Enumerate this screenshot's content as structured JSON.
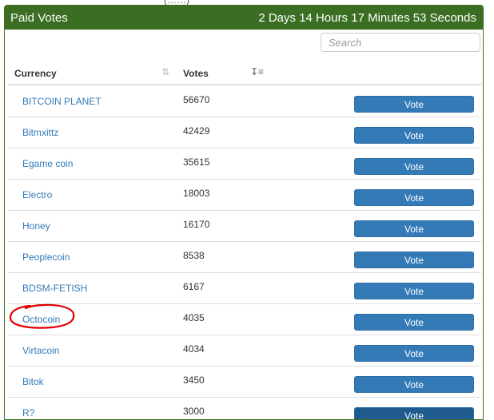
{
  "top_cut_text": "(……)",
  "panel": {
    "title": "Paid Votes",
    "countdown": "2 Days 14 Hours 17 Minutes 53 Seconds"
  },
  "search": {
    "placeholder": "Search"
  },
  "table": {
    "headers": {
      "currency": "Currency",
      "votes": "Votes"
    },
    "rows": [
      {
        "currency": "BITCOIN PLANET",
        "votes": "56670",
        "action": "Vote"
      },
      {
        "currency": "Bitmxittz",
        "votes": "42429",
        "action": "Vote"
      },
      {
        "currency": "Egame coin",
        "votes": "35615",
        "action": "Vote"
      },
      {
        "currency": "Electro",
        "votes": "18003",
        "action": "Vote"
      },
      {
        "currency": "Honey",
        "votes": "16170",
        "action": "Vote"
      },
      {
        "currency": "Peoplecoin",
        "votes": "8538",
        "action": "Vote"
      },
      {
        "currency": "BDSM-FETISH",
        "votes": "6167",
        "action": "Vote"
      },
      {
        "currency": "Octocoin",
        "votes": "4035",
        "action": "Vote"
      },
      {
        "currency": "Virtacoin",
        "votes": "4034",
        "action": "Vote"
      },
      {
        "currency": "Bitok",
        "votes": "3450",
        "action": "Vote"
      },
      {
        "currency": "R?",
        "votes": "3000",
        "action": "Vote"
      }
    ]
  },
  "colors": {
    "header_bg": "#3b6e22",
    "link": "#337ab7",
    "button": "#337ab7",
    "annotation": "#e00000"
  },
  "icons": {
    "currency_sort": "sort-neutral-icon",
    "votes_sort": "sort-desc-icon",
    "highlight": "red-circle-annotation"
  }
}
